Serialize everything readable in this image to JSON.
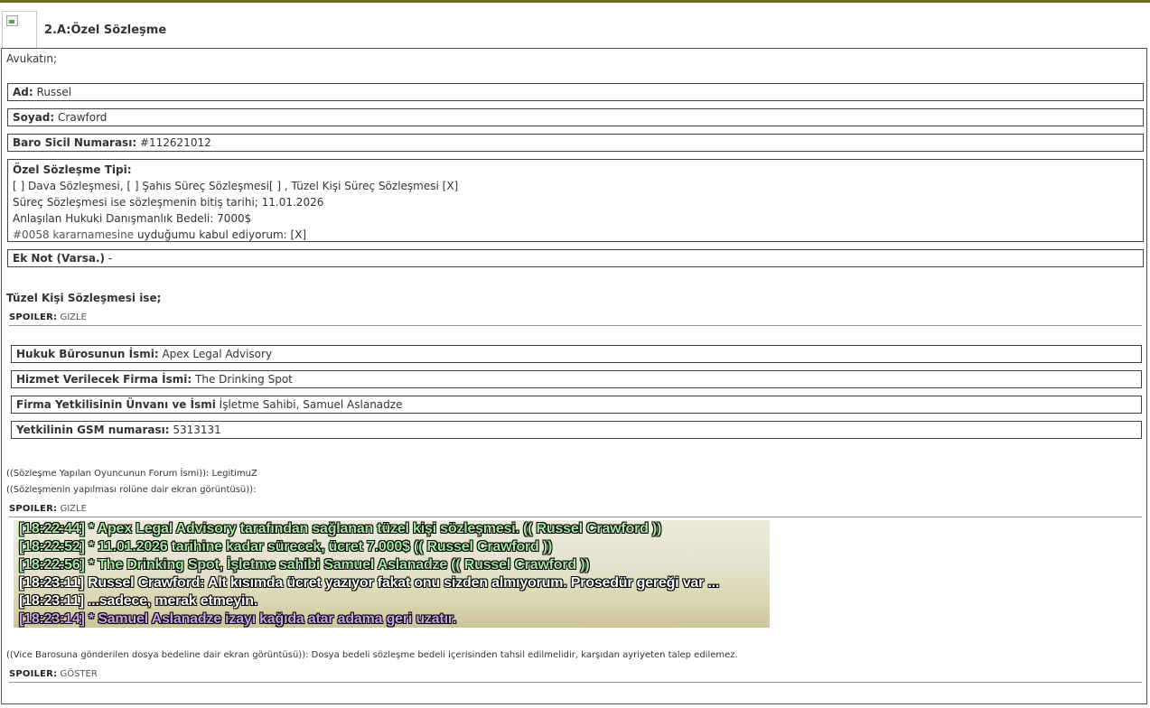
{
  "header": {
    "title": "2.A:Özel Sözleşme"
  },
  "intro": "Avukatın;",
  "fields": [
    {
      "label": "Ad:",
      "value": "Russel"
    },
    {
      "label": "Soyad:",
      "value": "Crawford"
    },
    {
      "label": "Baro Sicil Numarası:",
      "value": "#112621012"
    }
  ],
  "contract": {
    "label": "Özel Sözleşme Tipi:",
    "line1": "[ ] Dava Sözleşmesi, [ ] Şahıs Süreç Sözleşmesi[ ] , Tüzel Kişi Süreç Sözleşmesi [X]",
    "line2": "Süreç Sözleşmesi ise sözleşmenin bitiş tarihi; 11.01.2026",
    "line3": "Anlaşılan Hukuki Danışmanlık Bedeli: 7000$",
    "line4_link": "#0058 kararnamesine",
    "line4_rest": " uyduğumu kabul ediyorum: [X]"
  },
  "extra_note": {
    "label": "Ek Not (Varsa.)",
    "value": " -"
  },
  "corporate": {
    "heading": "Tüzel Kişi Sözleşmesi ise;",
    "spoiler_label": "SPOILER:",
    "spoiler_toggle": "GIZLE",
    "fields": [
      {
        "label": "Hukuk Bürosunun İsmi:",
        "value": "Apex Legal Advisory"
      },
      {
        "label": "Hizmet Verilecek Firma İsmi:",
        "value": "The Drinking Spot"
      },
      {
        "label": "Firma Yetkilisinin Ünvanı ve İsmi",
        "value": "İşletme Sahibi, Samuel Aslanadze"
      },
      {
        "label": "Yetkilinin GSM numarası:",
        "value": "5313131"
      }
    ]
  },
  "forum_name": "((Sözleşme Yapılan Oyuncunun Forum İsmi)): LegitimuZ",
  "screenshot_caption": "((Sözleşmenin yapılması rolüne dair ekran görüntüsü)):",
  "screenshot_spoiler": {
    "label": "SPOILER:",
    "toggle": "GIZLE"
  },
  "chat_lines": [
    {
      "text": "[18:22:44] * Apex Legal Advisory tarafından sağlanan tüzel kişi sözleşmesi. (( Russel Crawford ))",
      "color": "#a8e6a0"
    },
    {
      "text": "[18:22:52] * 11.01.2026 tarihine kadar sürecek, ücret 7.000$ (( Russel Crawford ))",
      "color": "#a8e6a0"
    },
    {
      "text": "[18:22:56] * The Drinking Spot, İşletme sahibi Samuel Aslanadze (( Russel Crawford ))",
      "color": "#a8e6a0"
    },
    {
      "text": "[18:23:11] Russel Crawford: Alt kısımda ücret yazıyor fakat onu sizden almıyorum. Prosedür gereği var ...",
      "color": "#ffffff"
    },
    {
      "text": "[18:23:11] ...sadece, merak etmeyin.",
      "color": "#ffffff"
    },
    {
      "text": "[18:23:14] * Samuel Aslanadze izayı kağıda atar adama geri uzatır.",
      "color": "#c9a2ea"
    }
  ],
  "fee_caption": "((Vice Barosuna gönderilen dosya bedeline dair ekran görüntüsü)): Dosya bedeli sözleşme bedeli içerisinden tahsil edilmelidir, karşıdan ayriyeten talep edilemez.",
  "fee_spoiler": {
    "label": "SPOILER:",
    "toggle": "GÖSTER"
  }
}
